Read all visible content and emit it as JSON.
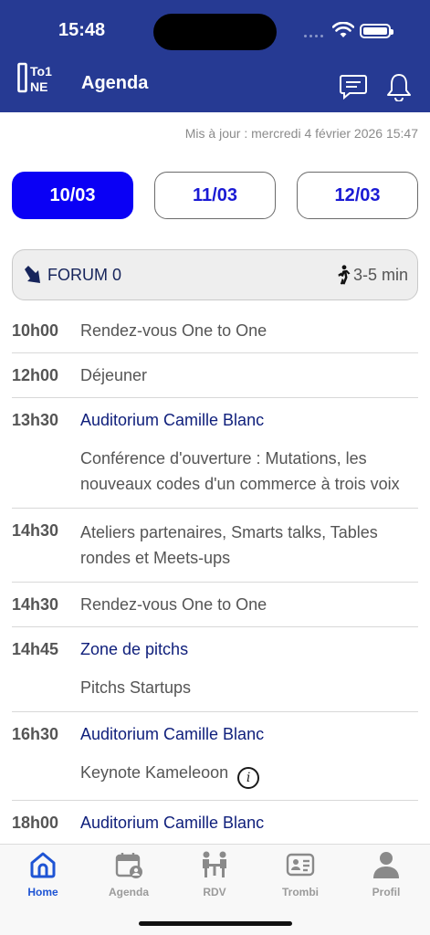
{
  "status_bar": {
    "time": "15:48"
  },
  "header": {
    "title": "Agenda",
    "logo_text": "OTo1NE"
  },
  "updated": "Mis à jour : mercredi 4 février 2026 15:47",
  "day_tabs": [
    {
      "label": "10/03",
      "active": true
    },
    {
      "label": "11/03",
      "active": false
    },
    {
      "label": "12/03",
      "active": false
    }
  ],
  "location": {
    "name": "FORUM 0",
    "walk_time": "3-5 min"
  },
  "schedule": [
    {
      "time": "10h00",
      "room": "",
      "title": "Rendez-vous One to One"
    },
    {
      "time": "12h00",
      "room": "",
      "title": "Déjeuner"
    },
    {
      "time": "13h30",
      "room": "Auditorium Camille Blanc",
      "title": "Conférence d'ouverture : Mutations, les nouveaux codes d'un commerce à trois voix"
    },
    {
      "time": "14h30",
      "room": "",
      "title": "Ateliers partenaires, Smarts talks, Tables rondes et Meets-ups"
    },
    {
      "time": "14h30",
      "room": "",
      "title": "Rendez-vous One to One"
    },
    {
      "time": "14h45",
      "room": "Zone de pitchs",
      "title": "Pitchs Startups"
    },
    {
      "time": "16h30",
      "room": "Auditorium Camille Blanc",
      "title": "Keynote Kameleoon"
    },
    {
      "time": "18h00",
      "room": "Auditorium Camille Blanc",
      "title": ""
    }
  ],
  "tabbar": [
    {
      "label": "Home",
      "icon": "home-icon",
      "active": true
    },
    {
      "label": "Agenda",
      "icon": "calendar-user-icon",
      "active": false
    },
    {
      "label": "RDV",
      "icon": "meeting-icon",
      "active": false
    },
    {
      "label": "Trombi",
      "icon": "id-card-icon",
      "active": false
    },
    {
      "label": "Profil",
      "icon": "profile-icon",
      "active": false
    }
  ],
  "colors": {
    "header": "#263a93",
    "active_tab": "#0a00f5",
    "room_text": "#10207c",
    "tab_active": "#1e54d4"
  }
}
